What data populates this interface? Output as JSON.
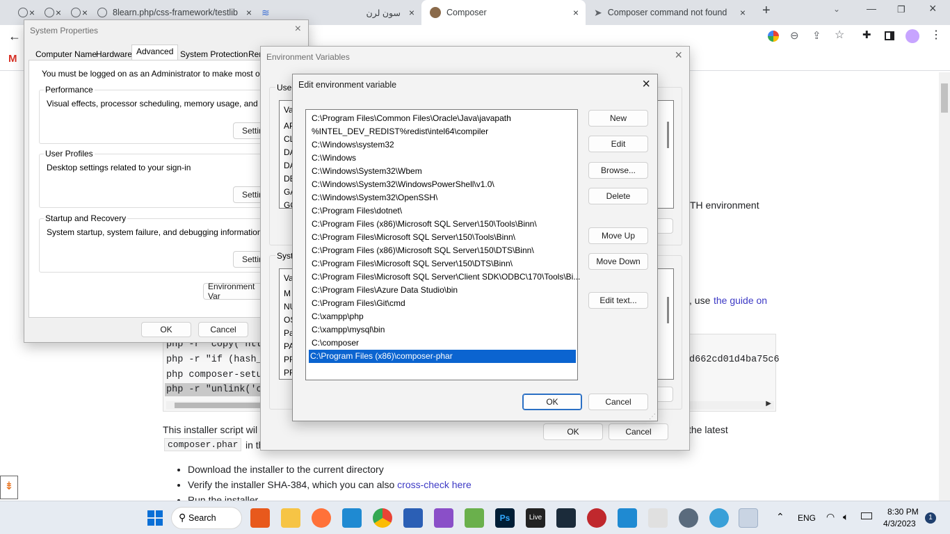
{
  "browser": {
    "tabs": [
      {
        "label": ""
      },
      {
        "label": ""
      },
      {
        "label": ""
      },
      {
        "label": "8learn.php/css-framework/testlib"
      },
      {
        "label": ""
      },
      {
        "label": "سون لرن"
      },
      {
        "label": "Composer"
      },
      {
        "label": "Composer command not found"
      }
    ],
    "new_tab": "+",
    "gmail_letter": "M"
  },
  "page": {
    "path_text": "TH environment",
    "guide_prefix": ", use",
    "guide_link": "the guide on",
    "code_lines": [
      "php -r \"copy('htt",
      "php -r \"if (hash_",
      "php composer-setu",
      "php -r \"unlink('c"
    ],
    "hash_fragment": "d662cd01d4ba75c6",
    "installer_text": "This installer script wil",
    "latest_text": "the latest",
    "composer_phar": "composer.phar",
    "in_th": "in th",
    "bullets": [
      "Download the installer to the current directory",
      "Verify the installer SHA-384, which you can also",
      "Run the installer"
    ],
    "cross_check_link": "cross-check here"
  },
  "sysprops": {
    "title": "System Properties",
    "tabs": [
      "Computer Name",
      "Hardware",
      "Advanced",
      "System Protection",
      "Remo"
    ],
    "admin_note": "You must be logged on as an Administrator to make most of these c",
    "performance": {
      "label": "Performance",
      "desc": "Visual effects, processor scheduling, memory usage, and virtual me",
      "button": "Setting"
    },
    "profiles": {
      "label": "User Profiles",
      "desc": "Desktop settings related to your sign-in",
      "button": "Setting"
    },
    "startup": {
      "label": "Startup and Recovery",
      "desc": "System startup, system failure, and debugging information",
      "button": "Setting"
    },
    "env_button": "Environment Var",
    "ok": "OK",
    "cancel": "Cancel"
  },
  "envvars": {
    "title": "Environment Variables",
    "user_label": "User",
    "user_col": "Va",
    "user_rows": [
      "AP",
      "CL",
      "DA",
      "DA",
      "DE",
      "GA",
      "GC"
    ],
    "system_label": "Syste",
    "system_col": "Va",
    "system_rows": [
      "M",
      "NU",
      "OS",
      "Pa",
      "PA",
      "PR",
      "PR"
    ],
    "ok": "OK",
    "cancel": "Cancel"
  },
  "editvar": {
    "title": "Edit environment variable",
    "paths": [
      "C:\\Program Files\\Common Files\\Oracle\\Java\\javapath",
      "%INTEL_DEV_REDIST%redist\\intel64\\compiler",
      "C:\\Windows\\system32",
      "C:\\Windows",
      "C:\\Windows\\System32\\Wbem",
      "C:\\Windows\\System32\\WindowsPowerShell\\v1.0\\",
      "C:\\Windows\\System32\\OpenSSH\\",
      "C:\\Program Files\\dotnet\\",
      "C:\\Program Files (x86)\\Microsoft SQL Server\\150\\Tools\\Binn\\",
      "C:\\Program Files\\Microsoft SQL Server\\150\\Tools\\Binn\\",
      "C:\\Program Files (x86)\\Microsoft SQL Server\\150\\DTS\\Binn\\",
      "C:\\Program Files\\Microsoft SQL Server\\150\\DTS\\Binn\\",
      "C:\\Program Files\\Microsoft SQL Server\\Client SDK\\ODBC\\170\\Tools\\Bi...",
      "C:\\Program Files\\Azure Data Studio\\bin",
      "C:\\Program Files\\Git\\cmd",
      "C:\\xampp\\php",
      "C:\\xampp\\mysql\\bin",
      "C:\\composer",
      "C:\\Program Files (x86)\\composer-phar"
    ],
    "buttons": {
      "new": "New",
      "edit": "Edit",
      "browse": "Browse...",
      "delete": "Delete",
      "move_up": "Move Up",
      "move_down": "Move Down",
      "edit_text": "Edit text...",
      "ok": "OK",
      "cancel": "Cancel"
    }
  },
  "taskbar": {
    "search": "Search",
    "lang": "ENG",
    "time": "8:30 PM",
    "date": "4/3/2023",
    "notif_count": "1"
  }
}
